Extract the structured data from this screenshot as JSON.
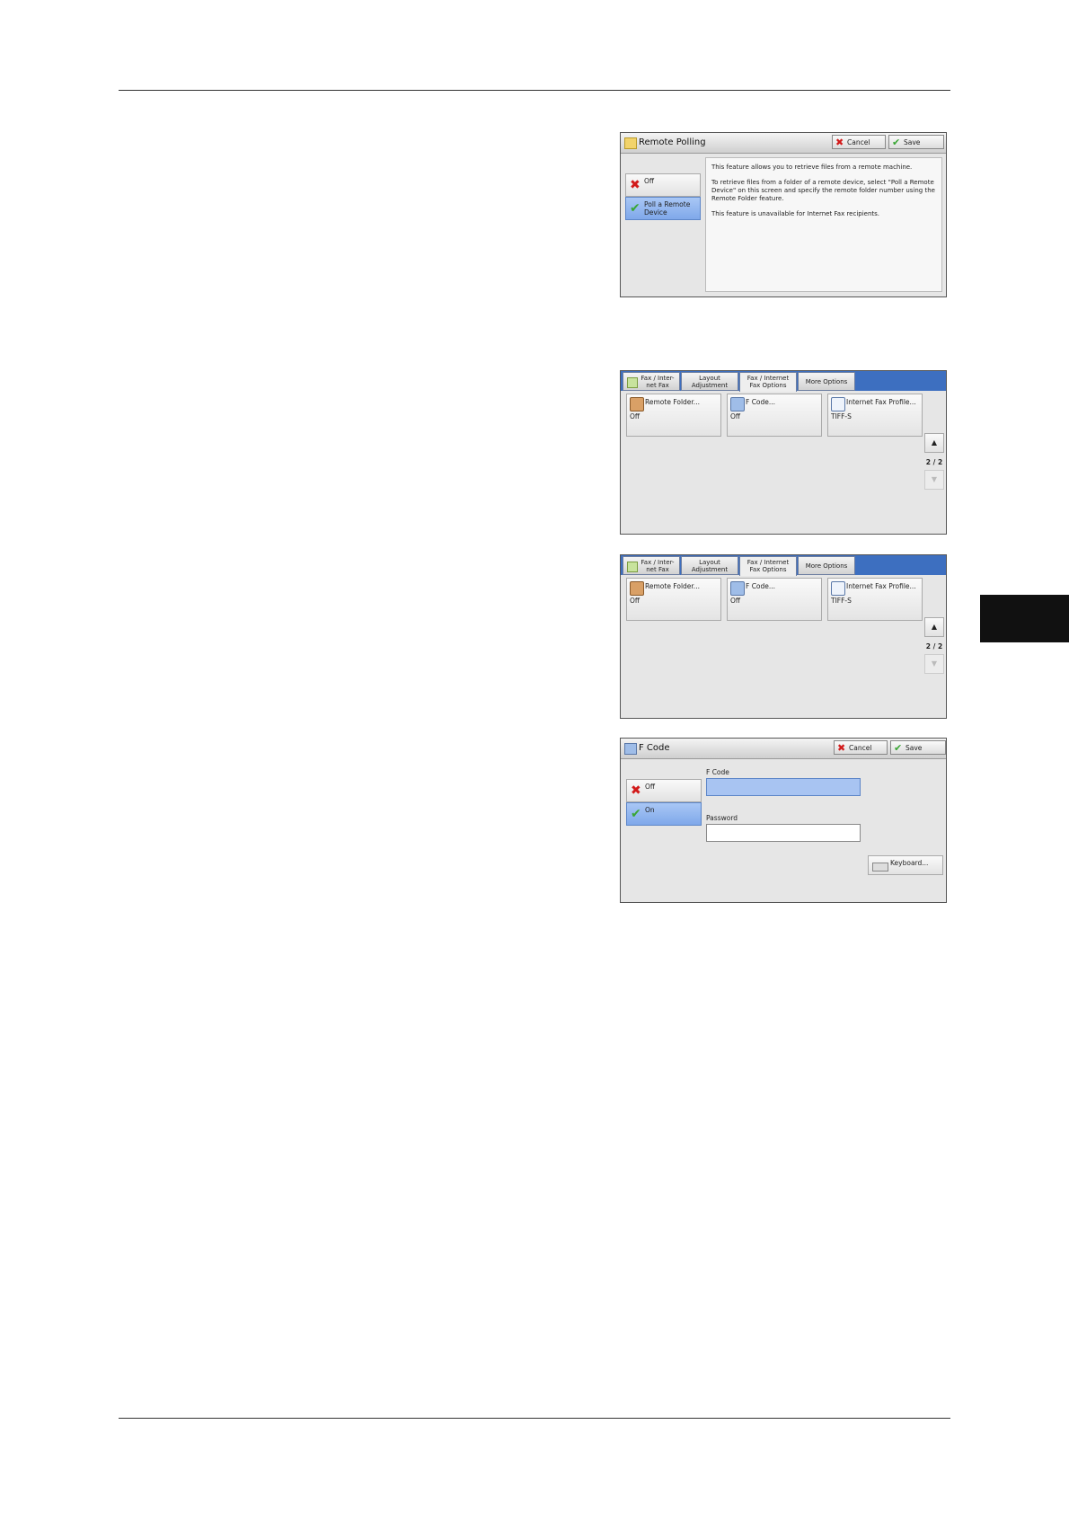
{
  "remote_polling": {
    "title": "Remote Polling",
    "cancel_label": "Cancel",
    "save_label": "Save",
    "options": [
      {
        "label": "Off",
        "selected": false,
        "icon": "x-icon"
      },
      {
        "label": "Poll a Remote Device",
        "selected": true,
        "icon": "check-icon"
      }
    ],
    "info": [
      "This feature allows you to retrieve files from a remote machine.",
      "To retrieve files from a folder of a remote device, select \"Poll a Remote Device\" on this screen and specify the remote folder number using the Remote Folder feature.",
      "This feature is unavailable for Internet Fax recipients."
    ]
  },
  "fax_options_screens": [
    {
      "tabs": [
        {
          "label": "Fax / Inter-\nnet Fax",
          "active": false
        },
        {
          "label": "Layout\nAdjustment",
          "active": false
        },
        {
          "label": "Fax / Internet\nFax Options",
          "active": true
        },
        {
          "label": "More Options",
          "active": false
        }
      ],
      "features": [
        {
          "label": "Remote Folder...",
          "value": "Off",
          "icon": "remote-folder-icon"
        },
        {
          "label": "F Code...",
          "value": "Off",
          "icon": "f-code-icon"
        },
        {
          "label": "Internet Fax Profile...",
          "value": "TIFF-S",
          "icon": "internet-fax-profile-icon"
        }
      ],
      "page": "2 / 2"
    },
    {
      "tabs": [
        {
          "label": "Fax / Inter-\nnet Fax",
          "active": false
        },
        {
          "label": "Layout\nAdjustment",
          "active": false
        },
        {
          "label": "Fax / Internet\nFax Options",
          "active": true
        },
        {
          "label": "More Options",
          "active": false
        }
      ],
      "features": [
        {
          "label": "Remote Folder...",
          "value": "Off",
          "icon": "remote-folder-icon"
        },
        {
          "label": "F Code...",
          "value": "Off",
          "icon": "f-code-icon"
        },
        {
          "label": "Internet Fax Profile...",
          "value": "TIFF-S",
          "icon": "internet-fax-profile-icon"
        }
      ],
      "page": "2 / 2"
    }
  ],
  "f_code": {
    "title": "F Code",
    "cancel_label": "Cancel",
    "save_label": "Save",
    "options": [
      {
        "label": "Off",
        "selected": false
      },
      {
        "label": "On",
        "selected": true
      }
    ],
    "f_code_label": "F Code",
    "f_code_value": "",
    "password_label": "Password",
    "password_value": "",
    "keyboard_label": "Keyboard..."
  },
  "colors": {
    "selected": "#7fa8ea",
    "tabbar": "#3d6fc0",
    "side_tab": "#111111"
  }
}
